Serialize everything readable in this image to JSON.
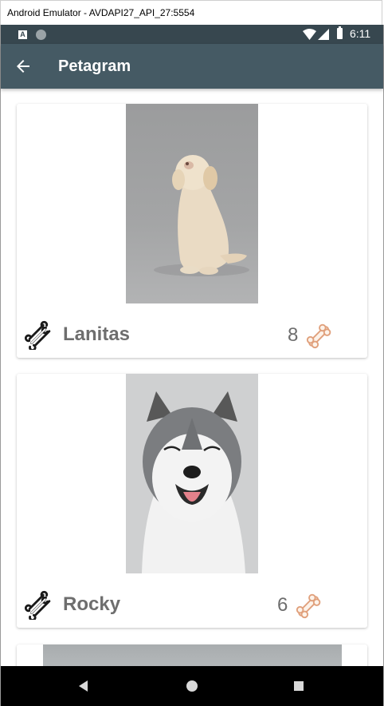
{
  "window": {
    "title": "Android Emulator - AVDAPI27_API_27:5554"
  },
  "status_bar": {
    "time": "6:11",
    "notification_badge": "A"
  },
  "toolbar": {
    "title": "Petagram"
  },
  "pets": [
    {
      "name": "Lanitas",
      "likes": "8"
    },
    {
      "name": "Rocky",
      "likes": "6"
    }
  ],
  "colors": {
    "status_bar": "#37474f",
    "toolbar": "#455a64",
    "bone_outline": "#1a1a1a",
    "bone_accent": "#e0a07c"
  },
  "icons": {
    "back": "arrow-back-icon",
    "rate": "bone-outline-icon",
    "likes": "bone-icon"
  }
}
